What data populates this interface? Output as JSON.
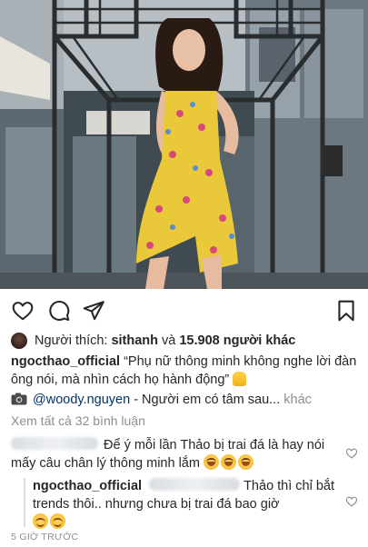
{
  "post": {
    "likes": {
      "prefix": "Người thích:",
      "first_user": "sithanh",
      "joiner": "và",
      "others": "15.908 người khác"
    },
    "caption": {
      "username": "ngocthao_official",
      "text": "“Phụ nữ thông minh không nghe lời đàn ông nói, mà nhìn cách họ hành động”",
      "mention": "@woody.nguyen",
      "after_mention": "- Người em có tâm sau...",
      "more": "khác"
    },
    "view_all_comments": "Xem tất cả 32 bình luận",
    "comments": [
      {
        "username_hidden": true,
        "text": "Để ý mỗi lần Thảo bị trai đá là hay nói mấy câu chân lý thông minh lắm"
      },
      {
        "username": "ngocthao_official",
        "reply_to_hidden": true,
        "text": "Thảo thì chỉ bắt trends thôi.. nhưng chưa bị trai đá bao giờ"
      }
    ],
    "timestamp": "5 GIỜ TRƯỚC"
  },
  "icons": {
    "like": "heart-icon",
    "comment": "comment-icon",
    "share": "send-icon",
    "save": "bookmark-icon",
    "comment_like": "heart-icon",
    "camera": "camera-icon"
  }
}
